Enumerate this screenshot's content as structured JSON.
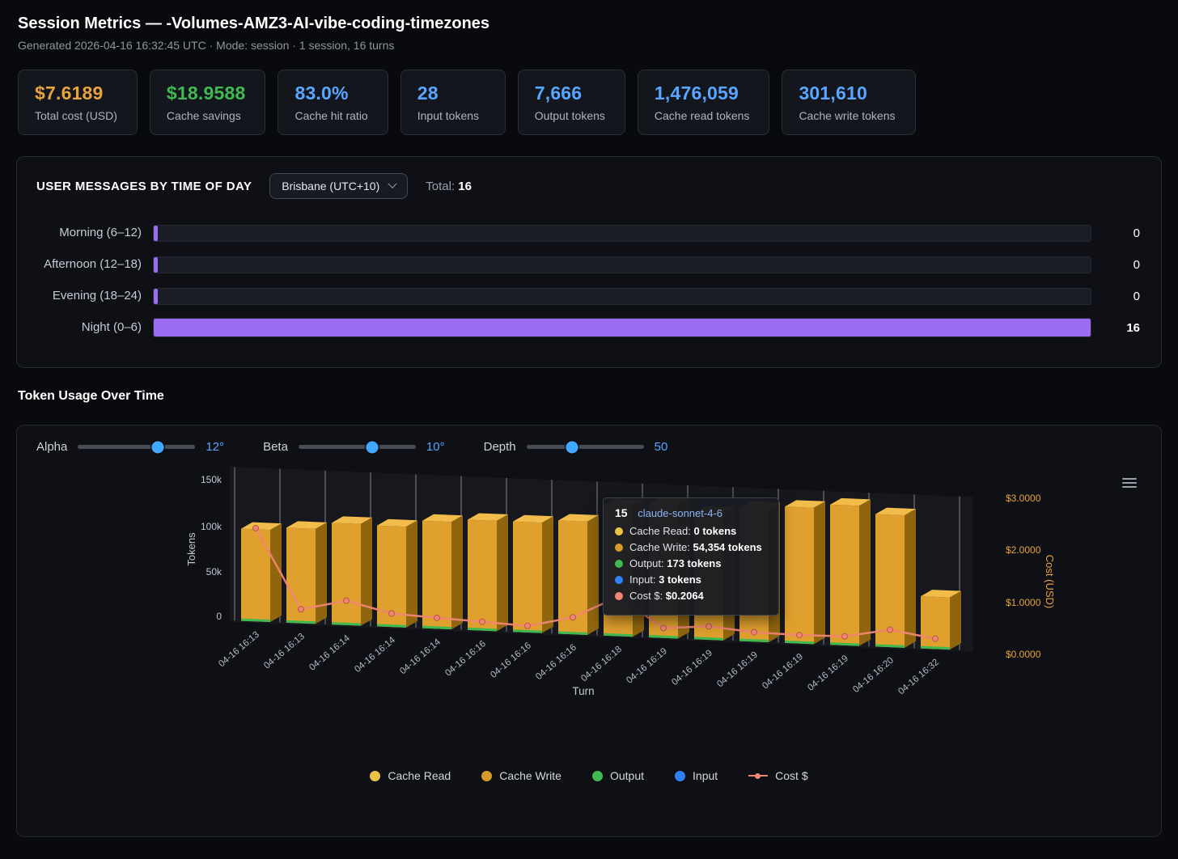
{
  "header": {
    "title": "Session Metrics — -Volumes-AMZ3-AI-vibe-coding-timezones",
    "subtitle": "Generated 2026-04-16 16:32:45 UTC  ·  Mode: session  ·  1 session, 16 turns"
  },
  "metric_cards": [
    {
      "value": "$7.6189",
      "label": "Total cost (USD)",
      "color": "#e8a33d"
    },
    {
      "value": "$18.9588",
      "label": "Cache savings",
      "color": "#3fb950"
    },
    {
      "value": "83.0%",
      "label": "Cache hit ratio",
      "color": "#58a6ff"
    },
    {
      "value": "28",
      "label": "Input tokens",
      "color": "#58a6ff"
    },
    {
      "value": "7,666",
      "label": "Output tokens",
      "color": "#58a6ff"
    },
    {
      "value": "1,476,059",
      "label": "Cache read tokens",
      "color": "#58a6ff"
    },
    {
      "value": "301,610",
      "label": "Cache write tokens",
      "color": "#58a6ff"
    }
  ],
  "time_of_day": {
    "title": "USER MESSAGES BY TIME OF DAY",
    "timezone": "Brisbane (UTC+10)",
    "total_label": "Total:",
    "total_value": "16",
    "max": 16,
    "bar_color": "#9b6cf4",
    "rows": [
      {
        "label": "Morning (6–12)",
        "value": 0,
        "display": "0"
      },
      {
        "label": "Afternoon (12–18)",
        "value": 0,
        "display": "0"
      },
      {
        "label": "Evening (18–24)",
        "value": 0,
        "display": "0"
      },
      {
        "label": "Night (0–6)",
        "value": 16,
        "display": "16"
      }
    ]
  },
  "token_section": {
    "title": "Token Usage Over Time",
    "controls": [
      {
        "label": "Alpha",
        "value": "12°",
        "pct": 68
      },
      {
        "label": "Beta",
        "value": "10°",
        "pct": 63
      },
      {
        "label": "Depth",
        "value": "50",
        "pct": 39
      }
    ],
    "legend": [
      {
        "label": "Cache Read",
        "color": "#ecc445",
        "type": "dot"
      },
      {
        "label": "Cache Write",
        "color": "#d69a28",
        "type": "dot"
      },
      {
        "label": "Output",
        "color": "#3fb950",
        "type": "dot"
      },
      {
        "label": "Input",
        "color": "#2f81f7",
        "type": "dot"
      },
      {
        "label": "Cost $",
        "color": "#f08573",
        "type": "line"
      }
    ],
    "tooltip": {
      "title": "15",
      "model": "claude-sonnet-4-6",
      "rows": [
        {
          "label": "Cache Read",
          "value": "0 tokens",
          "color": "#ecc445"
        },
        {
          "label": "Cache Write",
          "value": "54,354 tokens",
          "color": "#d69a28"
        },
        {
          "label": "Output",
          "value": "173 tokens",
          "color": "#3fb950"
        },
        {
          "label": "Input",
          "value": "3 tokens",
          "color": "#2f81f7"
        },
        {
          "label": "Cost $",
          "value": "$0.2064",
          "color": "#f08573"
        }
      ]
    }
  },
  "chart_data": [
    {
      "type": "bar",
      "orientation": "horizontal",
      "title": "USER MESSAGES BY TIME OF DAY",
      "timezone": "Brisbane (UTC+10)",
      "categories": [
        "Morning (6–12)",
        "Afternoon (12–18)",
        "Evening (18–24)",
        "Night (0–6)"
      ],
      "values": [
        0,
        0,
        0,
        16
      ],
      "total": 16,
      "xlim": [
        0,
        16
      ],
      "bar_color": "#9b6cf4"
    },
    {
      "type": "bar",
      "subtype": "3d-column-with-line",
      "title": "Token Usage Over Time",
      "xlabel": "Turn",
      "ylabel": "Tokens",
      "y2label": "Cost (USD)",
      "ylim": [
        0,
        150000
      ],
      "y2lim": [
        0,
        3
      ],
      "y_ticks": [
        "0",
        "50k",
        "100k",
        "150k"
      ],
      "y2_ticks": [
        "$0.0000",
        "$1.0000",
        "$2.0000",
        "$3.0000"
      ],
      "categories": [
        "04-16 16:13",
        "04-16 16:13",
        "04-16 16:14",
        "04-16 16:14",
        "04-16 16:14",
        "04-16 16:16",
        "04-16 16:16",
        "04-16 16:16",
        "04-16 16:18",
        "04-16 16:19",
        "04-16 16:19",
        "04-16 16:19",
        "04-16 16:19",
        "04-16 16:19",
        "04-16 16:20",
        "04-16 16:32"
      ],
      "series": [
        {
          "name": "Cache Write (tokens, est.)",
          "axis": "left",
          "values": [
            96000,
            99000,
            106000,
            105000,
            112000,
            115000,
            115000,
            118000,
            136000,
            139000,
            132000,
            139000,
            142000,
            146000,
            138000,
            54354
          ]
        },
        {
          "name": "Cost $ (USD, est.)",
          "axis": "right",
          "values": [
            1.87,
            0.28,
            0.49,
            0.27,
            0.22,
            0.18,
            0.13,
            0.34,
            0.79,
            0.2,
            0.27,
            0.19,
            0.17,
            0.18,
            0.35,
            0.2064
          ]
        }
      ],
      "legend": [
        "Cache Read",
        "Cache Write",
        "Output",
        "Input",
        "Cost $"
      ],
      "legend_position": "bottom",
      "grid": true,
      "bar_colors": {
        "front": "#dfa02e",
        "top": "#f2bc4a",
        "side": "#8f660f",
        "base_strip": "#3fb950"
      },
      "line_color": "#f08573",
      "right_axis_color": "#e8a33d"
    }
  ]
}
